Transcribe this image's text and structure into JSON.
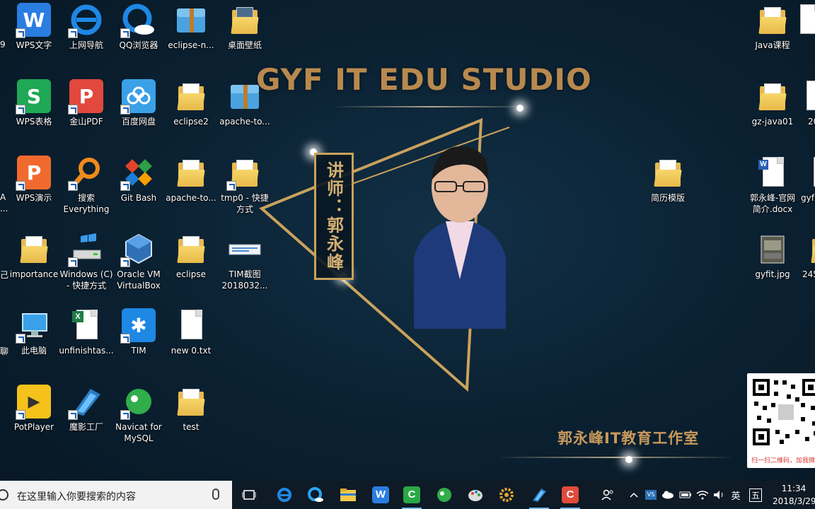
{
  "wallpaper": {
    "title": "GYF IT EDU STUDIO",
    "lecturer": "讲师：郭永峰",
    "studio_cn": "郭永峰IT教育工作室",
    "qr_caption": "扫一扫二维码，加我微"
  },
  "edge_labels": [
    "9",
    "A",
    "...",
    "己",
    "聊"
  ],
  "icons": {
    "wps_writer": "WPS文字",
    "web_nav": "上网导航",
    "qq_browser": "QQ浏览器",
    "eclipse_n": "eclipse-n...",
    "wallpaper_folder": "桌面壁纸",
    "wps_sheets": "WPS表格",
    "jinshan_pdf": "金山PDF",
    "baidu_pan": "百度网盘",
    "eclipse2": "eclipse2",
    "apache_to_1": "apache-to...",
    "wps_present": "WPS演示",
    "everything": "搜索\nEverything",
    "git_bash": "Git Bash",
    "apache_to_2": "apache-to...",
    "tmp0": "tmp0 - 快捷\n方式",
    "importance": "importance",
    "windows_c": "Windows (C)\n- 快捷方式",
    "virtualbox": "Oracle VM\nVirtualBox",
    "eclipse": "eclipse",
    "tim_screenshot": "TIM截图\n2018032...",
    "this_pc": "此电脑",
    "unfinished": "unfinishtas...",
    "tim": "TIM",
    "new_txt": "new  0.txt",
    "potplayer": "PotPlayer",
    "moying": "魔影工厂",
    "navicat": "Navicat for\nMySQL",
    "test": "test",
    "resume_template": "简历模版",
    "java_course": "Java课程",
    "gz_java01": "gz-java01",
    "intro_docx": "郭永峰-官网\n简介.docx",
    "gyfit_jpg": "gyfit.jpg",
    "cut_2": "20",
    "cut_gyf": "gyf",
    "cut_245": "245"
  },
  "taskbar": {
    "search_placeholder": "在这里输入你要搜索的内容",
    "ime_lang": "英",
    "ime_mode": "五",
    "time": "11:34",
    "date": "2018/3/29"
  },
  "colors": {
    "gold": "#b8894e",
    "wallpaper_bg": "#0b2233",
    "taskbar_bg": "#0e1a25"
  }
}
